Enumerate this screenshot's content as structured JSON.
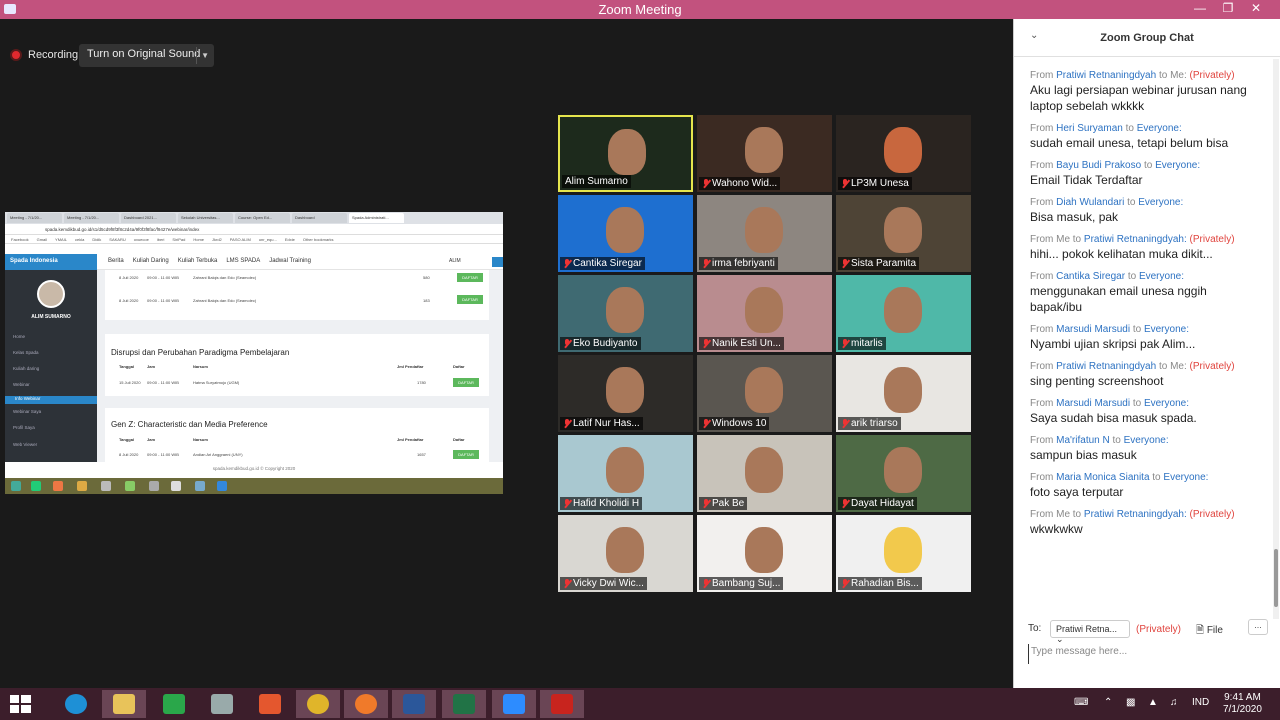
{
  "window": {
    "title": "Zoom Meeting"
  },
  "toolbar": {
    "recording": "Recording",
    "original_sound": "Turn on Original Sound"
  },
  "shared_screen": {
    "browser_tabs": [
      "Meeting - 7/1/20...",
      "Meeting - 7/1/20...",
      "Dashboard 2021...",
      "Sekolah Universitas...",
      "Course: Open Ed...",
      "Dashboard",
      "Spada Administrati..."
    ],
    "address": "spada.kemdikbud.go.id/s1/d5cd9f8f3f8c2d4a/9f0f3f8fac/f9427e/webinar/index",
    "bookmarks": [
      "Facebook",
      "Gmail",
      "YMAIL",
      "cekla",
      "Didik",
      "SAKARU",
      "oxuecoe",
      "iberi",
      "SiriPad",
      "Home",
      "Jkrd2",
      "PASO ALIM",
      "unr_equ...",
      "Edxie",
      "Other bookmarks"
    ],
    "brand": "Spada Indonesia",
    "nav": [
      "Berita",
      "Kuliah Daring",
      "Kuliah Terbuka",
      "LMS SPADA",
      "Jadwal Training"
    ],
    "user": "ALIM",
    "sidebar_name": "ALIM SUMARNO",
    "menu": [
      "Home",
      "Kelas Spada",
      "Kuliah daring",
      "Webinar",
      "Info Webinar",
      "Webinar Saya",
      "Profil Saya",
      "Web Viewer"
    ],
    "top_rows": [
      {
        "date": "8 Juli 2020",
        "time": "09:00 - 11:00 WIB",
        "speaker": "Zahrani Balqis dan Edo (Seamolec)",
        "count": "580",
        "btn": "DAFTAR"
      },
      {
        "date": "8 Juli 2020",
        "time": "09:00 - 11:00 WIB",
        "speaker": "Zahrani Balqis dan Edo (Seamolec)",
        "count": "183",
        "btn": "DAFTAR"
      }
    ],
    "card1": {
      "title": "Disrupsi dan Perubahan Paradigma Pembelajaran",
      "headers": [
        "Tanggal",
        "Jam",
        "Narsum",
        "Jml Pendaftar",
        "Daftar"
      ],
      "row": {
        "date": "15 Juli 2020",
        "time": "09:00 - 11:00 WIB",
        "speaker": "Hatma Suryatmojo (UGM)",
        "count": "1780",
        "btn": "DAFTAR"
      }
    },
    "card2": {
      "title": "Gen Z: Characteristic dan Media Preference",
      "headers": [
        "Tanggal",
        "Jam",
        "Narsum",
        "Jml Pendaftar",
        "Daftar"
      ],
      "row": {
        "date": "8 Juli 2020",
        "time": "09:00 - 11:00 WIB",
        "speaker": "Andian Ari Anggraeni (UNY)",
        "count": "1657",
        "btn": "DAFTAR"
      }
    },
    "footer": "spada.kemdikbud.go.id © Copyright 2020"
  },
  "participants": [
    {
      "name": "Alim Sumarno",
      "active": true
    },
    {
      "name": "Wahono Wid..."
    },
    {
      "name": "LP3M Unesa"
    },
    {
      "name": "Cantika Siregar"
    },
    {
      "name": "irma febriyanti"
    },
    {
      "name": "Sista Paramita"
    },
    {
      "name": "Eko Budiyanto"
    },
    {
      "name": "Nanik Esti Un..."
    },
    {
      "name": "mitarlis"
    },
    {
      "name": "Latif Nur Has..."
    },
    {
      "name": "Windows 10"
    },
    {
      "name": "arik triarso"
    },
    {
      "name": "Hafid Kholidi H"
    },
    {
      "name": "Pak Be"
    },
    {
      "name": "Dayat Hidayat"
    },
    {
      "name": "Vicky Dwi Wic..."
    },
    {
      "name": "Bambang Suj..."
    },
    {
      "name": "Rahadian Bis..."
    }
  ],
  "chat": {
    "title": "Zoom Group Chat",
    "messages": [
      {
        "from": "From",
        "sender": "Pratiwi Retnaningdyah",
        "to": "to Me:",
        "priv": "(Privately)",
        "text": "Aku lagi persiapan webinar jurusan nang laptop sebelah wkkkk"
      },
      {
        "from": "From",
        "sender": "Heri Suryaman",
        "to": "to",
        "recipient": "Everyone:",
        "text": "sudah email unesa, tetapi belum bisa"
      },
      {
        "from": "From",
        "sender": "Bayu Budi Prakoso",
        "to": "to",
        "recipient": "Everyone:",
        "text": "Email Tidak Terdaftar"
      },
      {
        "from": "From",
        "sender": "Diah Wulandari",
        "to": "to",
        "recipient": "Everyone:",
        "text": "Bisa masuk, pak"
      },
      {
        "from": "From Me to",
        "sender": "Pratiwi Retnaningdyah:",
        "priv": "(Privately)",
        "text": "hihi... pokok kelihatan muka dikit..."
      },
      {
        "from": "From",
        "sender": "Cantika Siregar",
        "to": "to",
        "recipient": "Everyone:",
        "text": "menggunakan email unesa nggih bapak/ibu"
      },
      {
        "from": "From",
        "sender": "Marsudi Marsudi",
        "to": "to",
        "recipient": "Everyone:",
        "text": "Nyambi ujian skripsi pak Alim..."
      },
      {
        "from": "From",
        "sender": "Pratiwi Retnaningdyah",
        "to": "to Me:",
        "priv": "(Privately)",
        "text": "sing penting screenshoot"
      },
      {
        "from": "From",
        "sender": "Marsudi Marsudi",
        "to": "to",
        "recipient": "Everyone:",
        "text": "Saya sudah bisa masuk spada."
      },
      {
        "from": "From",
        "sender": "Ma'rifatun N",
        "to": "to",
        "recipient": "Everyone:",
        "text": "sampun bias masuk"
      },
      {
        "from": "From",
        "sender": "Maria Monica Sianita",
        "to": "to",
        "recipient": "Everyone:",
        "text": "foto saya terputar"
      },
      {
        "from": "From Me to",
        "sender": "Pratiwi Retnaningdyah:",
        "priv": "(Privately)",
        "text": "wkwkwkw"
      }
    ],
    "to_label": "To:",
    "to_value": "Pratiwi Retna...",
    "to_priv": "(Privately)",
    "file": "File",
    "more": "...",
    "placeholder": "Type message here..."
  },
  "taskbar": {
    "lang": "IND",
    "time": "9:41 AM",
    "date": "7/1/2020"
  }
}
